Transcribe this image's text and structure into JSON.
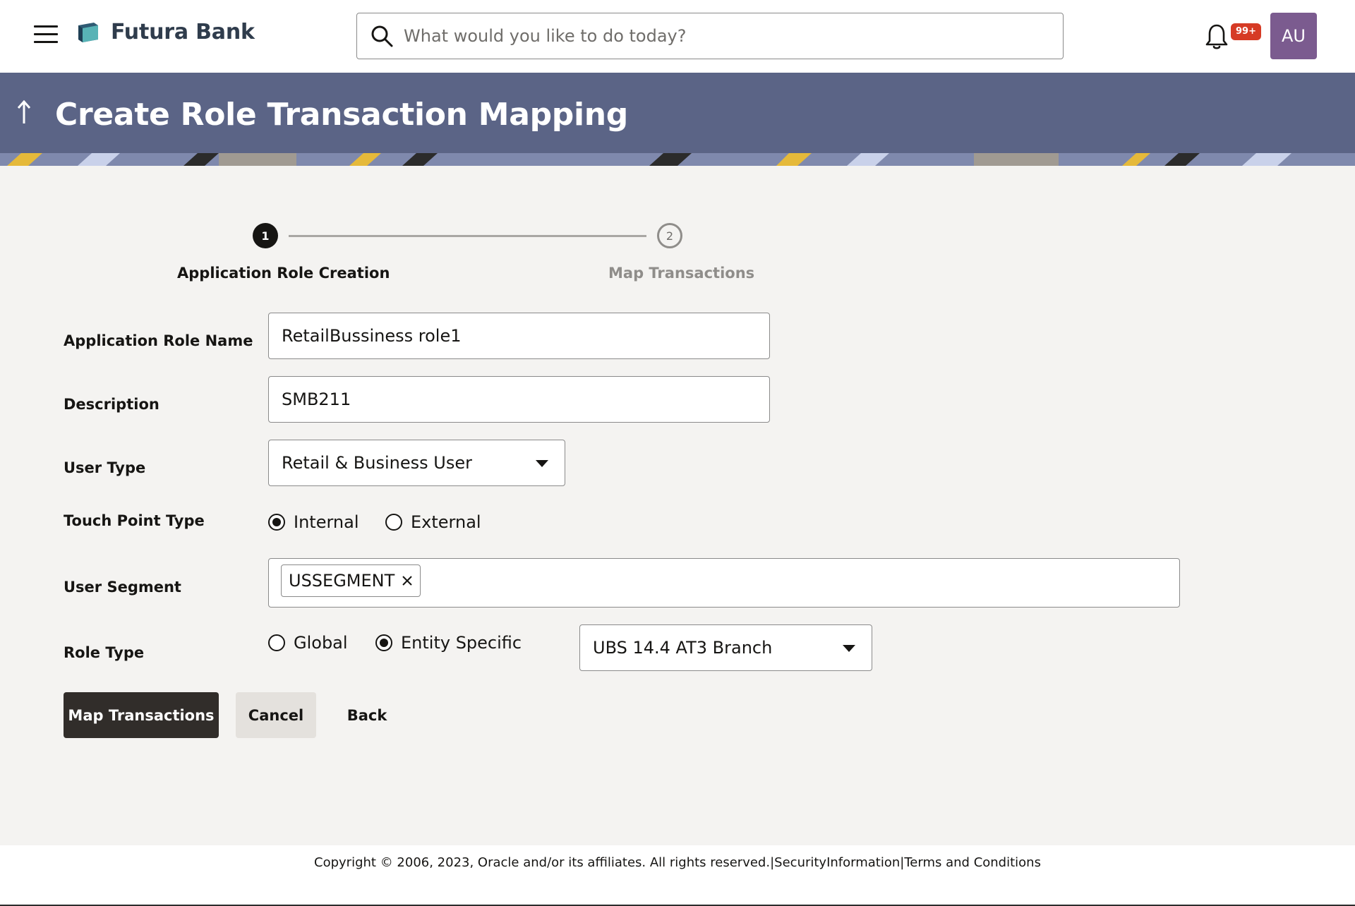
{
  "header": {
    "brand": "Futura Bank",
    "search_placeholder": "What would you like to do today?",
    "notification_count": "99+",
    "avatar_initials": "AU"
  },
  "banner": {
    "title": "Create Role Transaction Mapping"
  },
  "stepper": {
    "steps": [
      {
        "number": "1",
        "label": "Application Role Creation",
        "state": "active"
      },
      {
        "number": "2",
        "label": "Map Transactions",
        "state": "pending"
      }
    ]
  },
  "form": {
    "role_name": {
      "label": "Application Role Name",
      "value": "RetailBussiness role1"
    },
    "description": {
      "label": "Description",
      "value": "SMB211"
    },
    "user_type": {
      "label": "User Type",
      "value": "Retail & Business User"
    },
    "touch_point": {
      "label": "Touch Point Type",
      "options": [
        {
          "label": "Internal",
          "selected": true
        },
        {
          "label": "External",
          "selected": false
        }
      ]
    },
    "user_segment": {
      "label": "User Segment",
      "chips": [
        "USSEGMENT"
      ]
    },
    "role_type": {
      "label": "Role Type",
      "options": [
        {
          "label": "Global",
          "selected": false
        },
        {
          "label": "Entity Specific",
          "selected": true
        }
      ],
      "entity_value": "UBS 14.4 AT3 Branch"
    }
  },
  "actions": {
    "primary": "Map Transactions",
    "cancel": "Cancel",
    "back": "Back"
  },
  "footer": {
    "copyright": "Copyright © 2006, 2023, Oracle and/or its affiliates. All rights reserved.",
    "separator": "|",
    "security": "SecurityInformation",
    "terms": "Terms and Conditions"
  },
  "colors": {
    "banner": "#5b6486",
    "primary_button": "#312d2a",
    "badge": "#d63b25",
    "avatar": "#7b5b8f"
  }
}
